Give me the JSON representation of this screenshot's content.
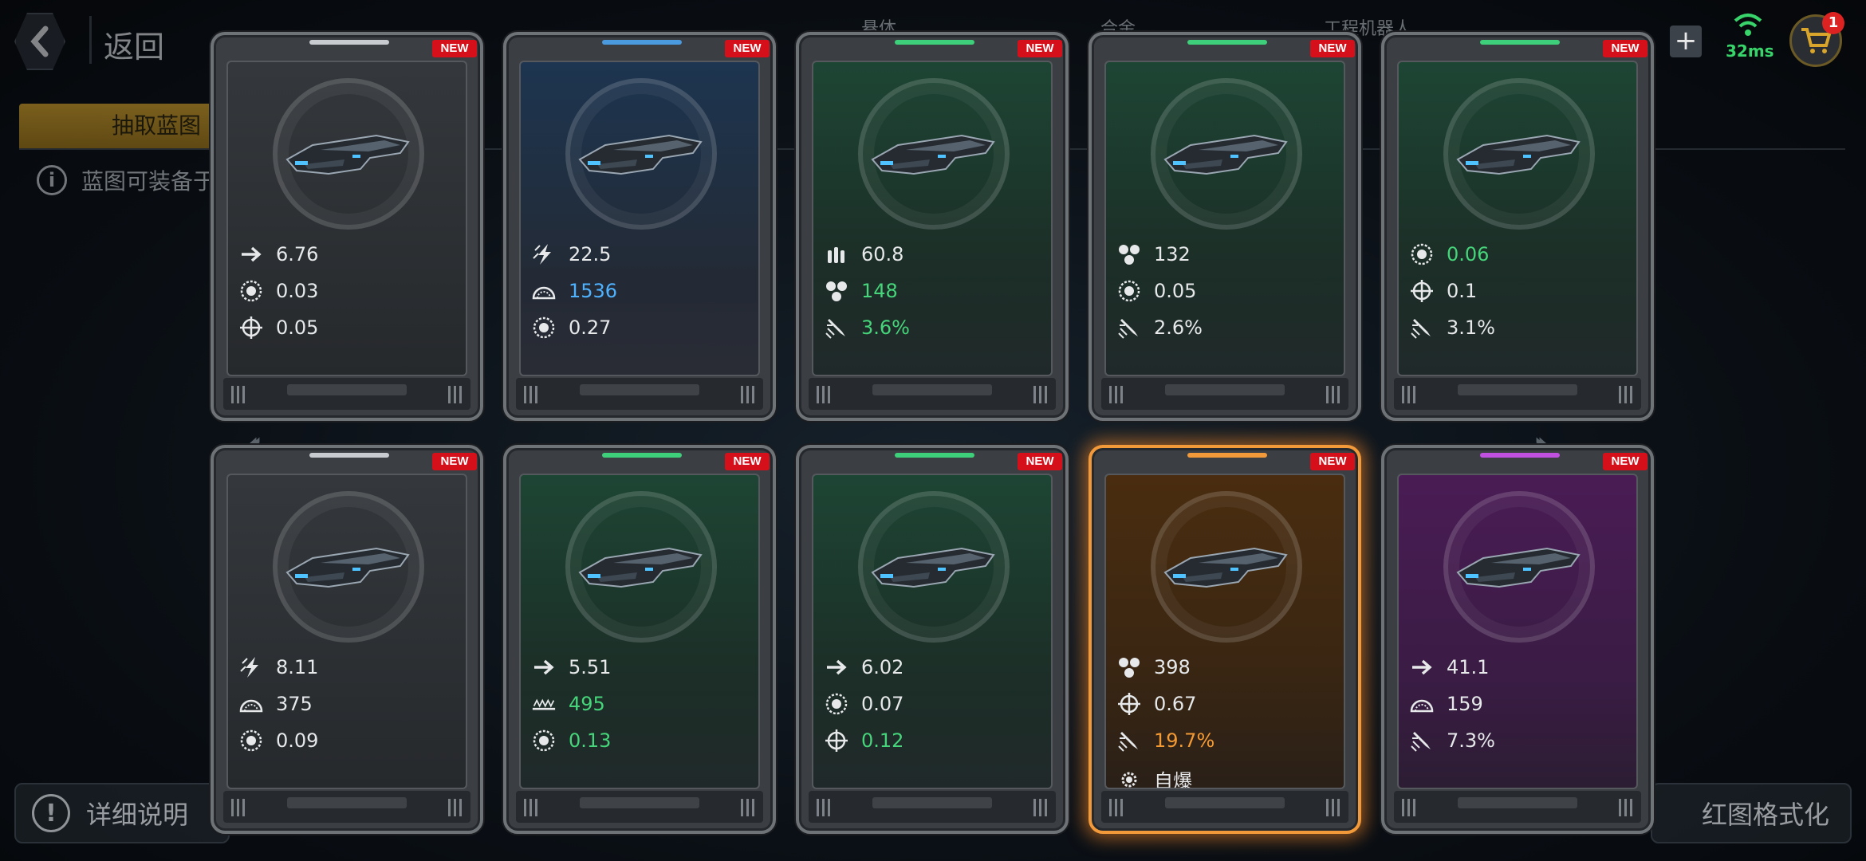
{
  "header": {
    "back_label": "返回",
    "resources": [
      "悬体",
      "合金",
      "工程机器人"
    ],
    "ping": "32ms",
    "cart_badge": "1"
  },
  "tabs": {
    "active": "抽取蓝图"
  },
  "info": {
    "text": "蓝图可装备于"
  },
  "footer": {
    "detail_label": "详细说明",
    "format_label": "红图格式化"
  },
  "rarity_colors": {
    "gray": "#c8ccd0",
    "blue": "#4a9ae0",
    "green": "#3ecf7a",
    "orange": "#f29a3a",
    "purple": "#c050e0"
  },
  "cards": [
    {
      "rarity": "gray",
      "new": "NEW",
      "stats": [
        {
          "icon": "arrow-icon",
          "value": "6.76",
          "color": "white"
        },
        {
          "icon": "target-ring-icon",
          "value": "0.03",
          "color": "white"
        },
        {
          "icon": "crosshair-icon",
          "value": "0.05",
          "color": "white"
        }
      ]
    },
    {
      "rarity": "blue",
      "new": "NEW",
      "stats": [
        {
          "icon": "lightning-icon",
          "value": "22.5",
          "color": "white"
        },
        {
          "icon": "shield-dome-icon",
          "value": "1536",
          "color": "blue"
        },
        {
          "icon": "target-ring-icon",
          "value": "0.27",
          "color": "white"
        }
      ]
    },
    {
      "rarity": "green",
      "new": "NEW",
      "stats": [
        {
          "icon": "ammo-icon",
          "value": "60.8",
          "color": "white"
        },
        {
          "icon": "cluster-icon",
          "value": "148",
          "color": "green"
        },
        {
          "icon": "missile-icon",
          "value": "3.6%",
          "color": "green"
        }
      ]
    },
    {
      "rarity": "green",
      "new": "NEW",
      "stats": [
        {
          "icon": "cluster-icon",
          "value": "132",
          "color": "white"
        },
        {
          "icon": "target-ring-icon",
          "value": "0.05",
          "color": "white"
        },
        {
          "icon": "missile-icon",
          "value": "2.6%",
          "color": "white"
        }
      ]
    },
    {
      "rarity": "green",
      "new": "NEW",
      "stats": [
        {
          "icon": "target-ring-icon",
          "value": "0.06",
          "color": "green"
        },
        {
          "icon": "crosshair-icon",
          "value": "0.1",
          "color": "white"
        },
        {
          "icon": "missile-icon",
          "value": "3.1%",
          "color": "white"
        }
      ]
    },
    {
      "rarity": "gray",
      "new": "NEW",
      "stats": [
        {
          "icon": "lightning-icon",
          "value": "8.11",
          "color": "white"
        },
        {
          "icon": "shield-dome-icon",
          "value": "375",
          "color": "white"
        },
        {
          "icon": "target-ring-icon",
          "value": "0.09",
          "color": "white"
        }
      ]
    },
    {
      "rarity": "green",
      "new": "NEW",
      "stats": [
        {
          "icon": "arrow-icon",
          "value": "5.51",
          "color": "white"
        },
        {
          "icon": "wave-icon",
          "value": "495",
          "color": "green"
        },
        {
          "icon": "target-ring-icon",
          "value": "0.13",
          "color": "green"
        }
      ]
    },
    {
      "rarity": "green",
      "new": "NEW",
      "stats": [
        {
          "icon": "arrow-icon",
          "value": "6.02",
          "color": "white"
        },
        {
          "icon": "target-ring-icon",
          "value": "0.07",
          "color": "white"
        },
        {
          "icon": "crosshair-icon",
          "value": "0.12",
          "color": "green"
        }
      ]
    },
    {
      "rarity": "orange",
      "new": "NEW",
      "highlight": true,
      "stats": [
        {
          "icon": "cluster-icon",
          "value": "398",
          "color": "white"
        },
        {
          "icon": "crosshair-icon",
          "value": "0.67",
          "color": "white"
        },
        {
          "icon": "missile-icon",
          "value": "19.7%",
          "color": "orange"
        },
        {
          "icon": "gear-icon",
          "value": "自爆",
          "color": "white"
        }
      ]
    },
    {
      "rarity": "purple",
      "new": "NEW",
      "stats": [
        {
          "icon": "arrow-icon",
          "value": "41.1",
          "color": "white"
        },
        {
          "icon": "shield-dome-icon",
          "value": "159",
          "color": "white"
        },
        {
          "icon": "missile-icon",
          "value": "7.3%",
          "color": "white"
        }
      ]
    }
  ]
}
